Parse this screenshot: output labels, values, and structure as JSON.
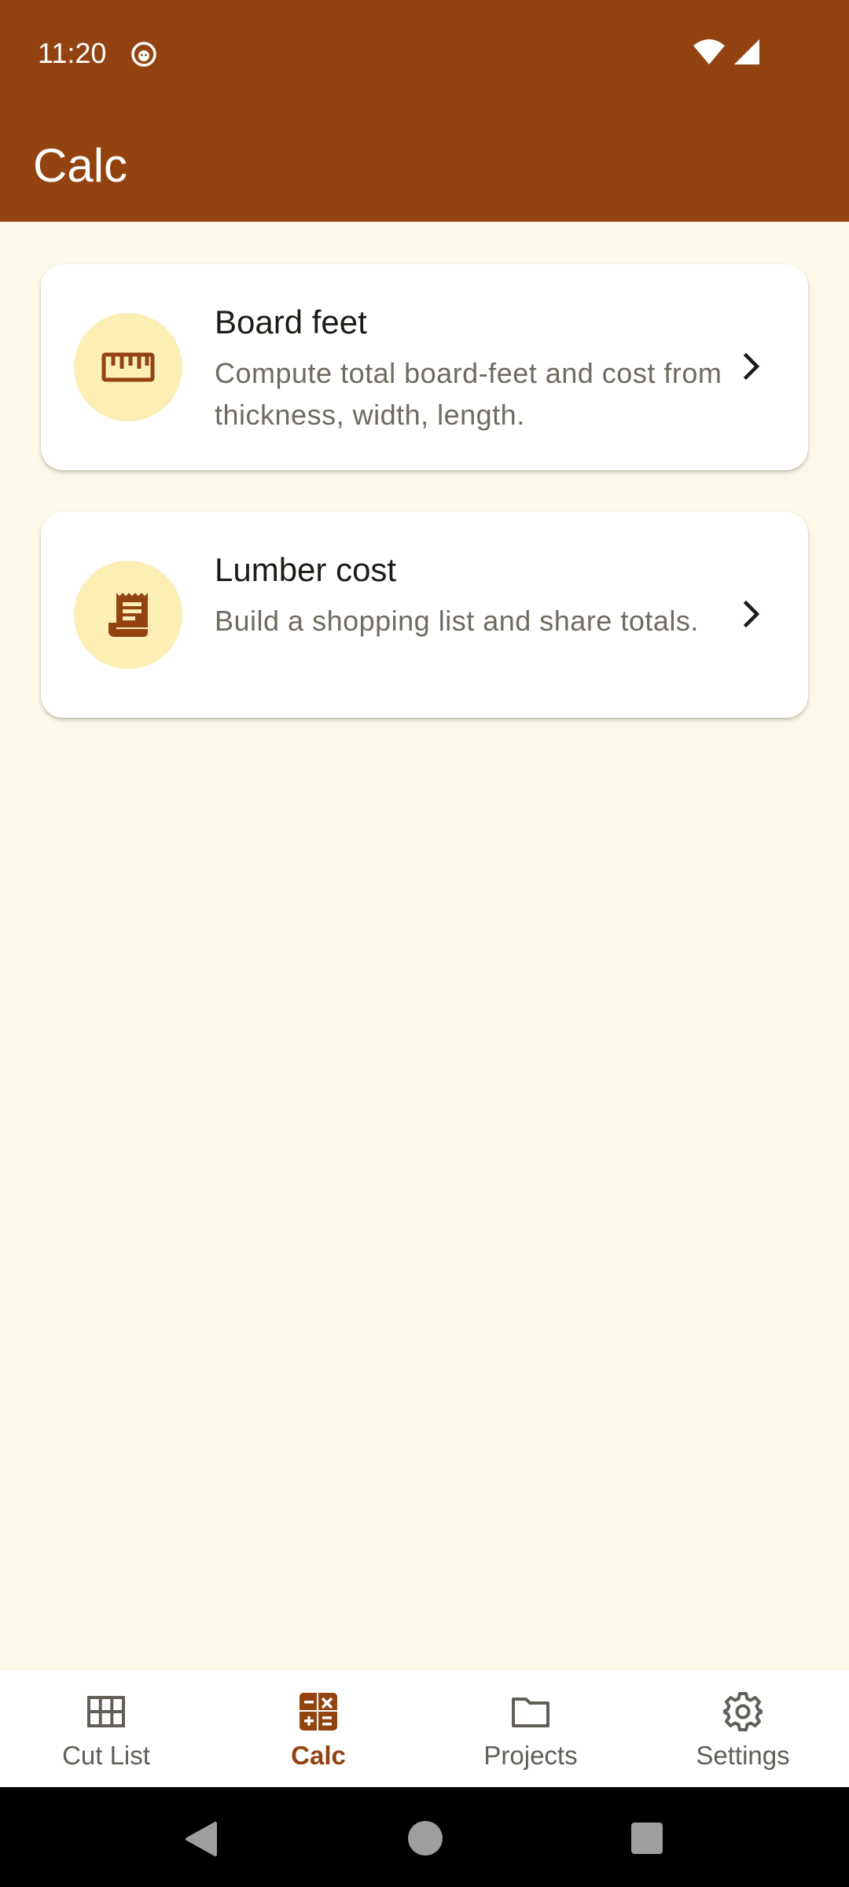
{
  "status_bar": {
    "time": "11:20"
  },
  "app_bar": {
    "title": "Calc"
  },
  "cards": [
    {
      "title": "Board feet",
      "description": "Compute total board-feet and cost from thickness, width, length.",
      "icon": "ruler-icon"
    },
    {
      "title": "Lumber cost",
      "description": "Build a shopping list and share totals.",
      "icon": "receipt-icon"
    }
  ],
  "bottom_nav": {
    "items": [
      {
        "label": "Cut List",
        "icon": "grid-icon",
        "active": false
      },
      {
        "label": "Calc",
        "icon": "calculator-icon",
        "active": true
      },
      {
        "label": "Projects",
        "icon": "folder-icon",
        "active": false
      },
      {
        "label": "Settings",
        "icon": "gear-icon",
        "active": false
      }
    ]
  },
  "colors": {
    "primary": "#924310",
    "background": "#fdf9e9",
    "icon_circle": "#fdeeb6",
    "card": "#ffffff"
  }
}
